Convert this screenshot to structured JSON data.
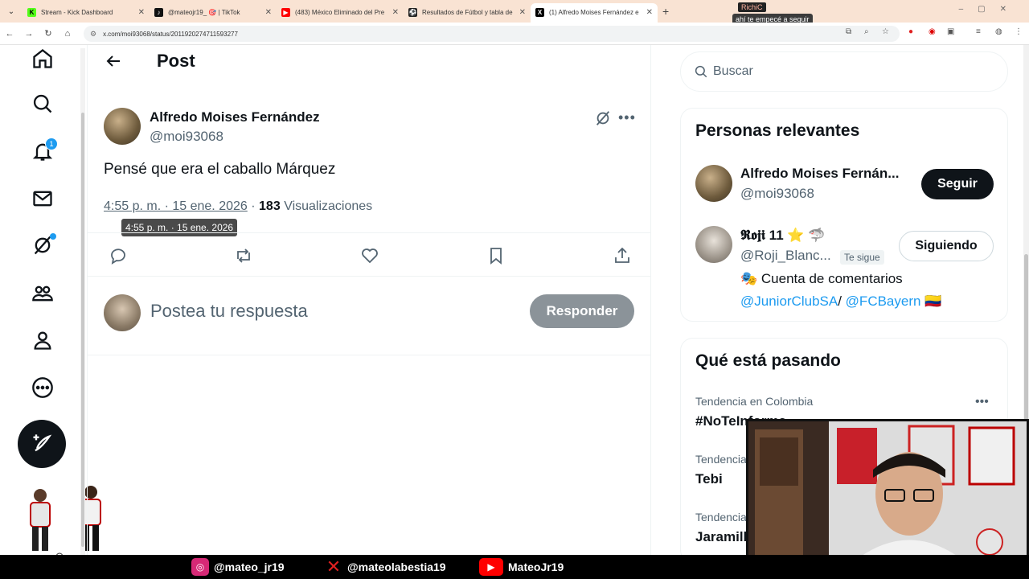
{
  "browser": {
    "tabs": [
      {
        "title": "Stream - Kick Dashboard",
        "favicon_color": "#53fc18",
        "favicon_glyph": "K"
      },
      {
        "title": "@mateojr19_ 🎯 | TikTok",
        "favicon_color": "#111111",
        "favicon_glyph": "♪"
      },
      {
        "title": "(483) México Eliminado del Pre",
        "favicon_color": "#ff0000",
        "favicon_glyph": "▶"
      },
      {
        "title": "Resultados de Fútbol y tabla de",
        "favicon_color": "#222222",
        "favicon_glyph": "⚽"
      },
      {
        "title": "(1) Alfredo Moises Fernández e",
        "favicon_color": "#000000",
        "favicon_glyph": "X"
      }
    ],
    "url": "x.com/moi93068/status/2011920274711593277",
    "overlay_label": "RichiC",
    "overlay_tooltip": "ahí te empecé a seguir"
  },
  "nav": {
    "items": [
      "home-icon",
      "search-icon",
      "bell-icon",
      "mail-icon",
      "grok-icon",
      "communities-icon",
      "profile-icon",
      "more-icon"
    ],
    "notification_count": "1"
  },
  "post": {
    "header_title": "Post",
    "author_name": "Alfredo Moises Fernández",
    "author_handle": "@moi93068",
    "text": "Pensé que era el caballo Márquez",
    "timestamp": "4:55 p. m. · 15 ene. 2026",
    "views_count": "183",
    "views_label": "Visualizaciones",
    "tooltip": "4:55 p. m. · 15 ene. 2026",
    "reply_placeholder": "Postea tu respuesta",
    "reply_button": "Responder"
  },
  "sidebar": {
    "search_placeholder": "Buscar",
    "relevant_title": "Personas relevantes",
    "people": [
      {
        "name": "Alfredo Moises Fernán...",
        "handle": "@moi93068",
        "button": "Seguir"
      },
      {
        "name": "𝕽𝖔𝖏𝖎 11",
        "name_emoji": "⭐ 🦈",
        "handle": "@Roji_Blanc...",
        "follows_you": "Te sigue",
        "button": "Siguiendo",
        "bio_emoji": "🎭",
        "bio_text": "Cuenta de comentarios",
        "bio_link1": "@JuniorClubSA",
        "bio_sep": "/",
        "bio_link2": "@FCBayern",
        "bio_flag": "🇨🇴"
      }
    ],
    "trends_title": "Qué está pasando",
    "trends": [
      {
        "category": "Tendencia en Colombia",
        "name": "#NoTeInforma"
      },
      {
        "category": "Tendencia",
        "name": "Tebi"
      },
      {
        "category": "Tendencia",
        "name": "Jaramill"
      }
    ]
  },
  "footer": {
    "instagram": "@mateo_jr19",
    "x": "@mateolabestia19",
    "youtube": "MateoJr19"
  },
  "colors": {
    "accent": "#1d9bf0",
    "text": "#0f1419",
    "muted": "#536471"
  }
}
